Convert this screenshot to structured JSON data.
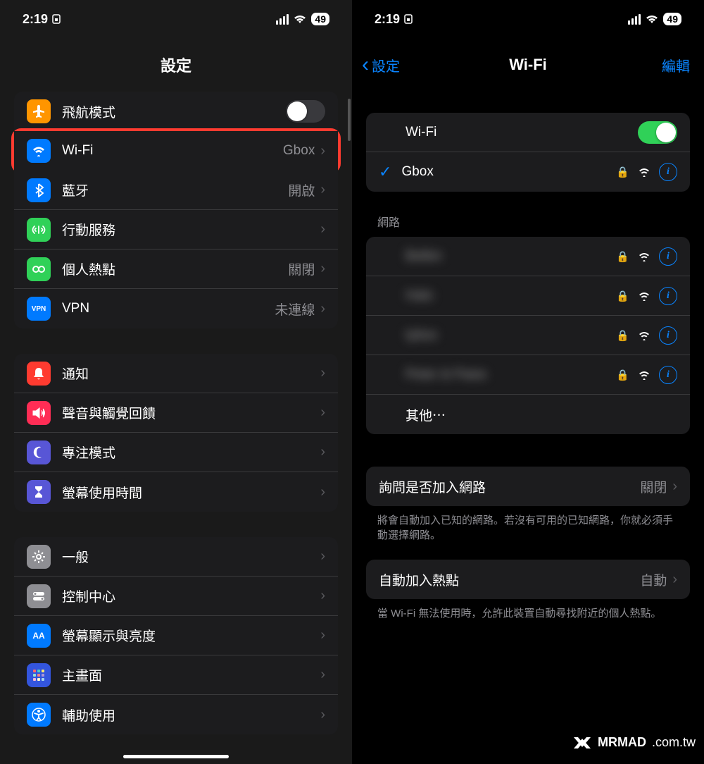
{
  "status": {
    "time": "2:19",
    "battery": "49"
  },
  "left": {
    "title": "設定",
    "rows": {
      "airplane": "飛航模式",
      "wifi": "Wi-Fi",
      "wifi_value": "Gbox",
      "bluetooth": "藍牙",
      "bluetooth_value": "開啟",
      "cellular": "行動服務",
      "hotspot": "個人熱點",
      "hotspot_value": "關閉",
      "vpn": "VPN",
      "vpn_value": "未連線",
      "notifications": "通知",
      "sounds": "聲音與觸覺回饋",
      "focus": "專注模式",
      "screentime": "螢幕使用時間",
      "general": "一般",
      "control": "控制中心",
      "display": "螢幕顯示與亮度",
      "home": "主畫面",
      "accessibility": "輔助使用"
    }
  },
  "right": {
    "back": "設定",
    "title": "Wi-Fi",
    "edit": "編輯",
    "wifi_label": "Wi-Fi",
    "connected": "Gbox",
    "networks_header": "網路",
    "networks": [
      "Belkin",
      "Halo",
      "tybox",
      "Peter & Paws"
    ],
    "other": "其他⋯",
    "ask_label": "詢問是否加入網路",
    "ask_value": "關閉",
    "ask_footer": "將會自動加入已知的網路。若沒有可用的已知網路，你就必須手動選擇網路。",
    "auto_label": "自動加入熱點",
    "auto_value": "自動",
    "auto_footer": "當 Wi-Fi 無法使用時，允許此裝置自動尋找附近的個人熱點。"
  },
  "watermark": {
    "brand": "MRMAD",
    "domain": ".com.tw"
  }
}
